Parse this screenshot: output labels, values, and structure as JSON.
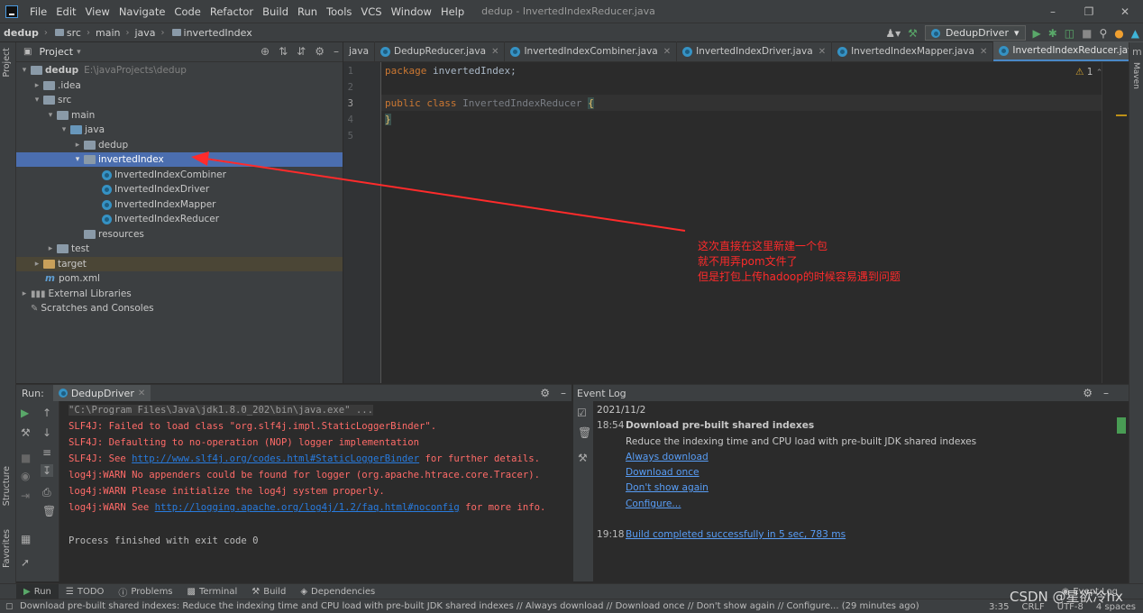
{
  "menubar": {
    "items": [
      "File",
      "Edit",
      "View",
      "Navigate",
      "Code",
      "Refactor",
      "Build",
      "Run",
      "Tools",
      "VCS",
      "Window",
      "Help"
    ],
    "window_title": "dedup - InvertedIndexReducer.java"
  },
  "navbar": {
    "crumbs": [
      "dedup",
      "src",
      "main",
      "java",
      "invertedIndex"
    ],
    "run_config": "DedupDriver"
  },
  "left_strip": {
    "tabs": [
      "Project",
      "Structure",
      "Favorites"
    ]
  },
  "right_strip": {
    "tabs": [
      "Maven"
    ]
  },
  "project": {
    "title": "Project",
    "tree": [
      {
        "label": "dedup",
        "extra": "E:\\javaProjects\\dedup"
      },
      {
        "label": ".idea"
      },
      {
        "label": "src"
      },
      {
        "label": "main"
      },
      {
        "label": "java"
      },
      {
        "label": "dedup"
      },
      {
        "label": "invertedIndex"
      },
      {
        "label": "InvertedIndexCombiner"
      },
      {
        "label": "InvertedIndexDriver"
      },
      {
        "label": "InvertedIndexMapper"
      },
      {
        "label": "InvertedIndexReducer"
      },
      {
        "label": "resources"
      },
      {
        "label": "test"
      },
      {
        "label": "target"
      },
      {
        "label": "pom.xml"
      },
      {
        "label": "External Libraries"
      },
      {
        "label": "Scratches and Consoles"
      }
    ]
  },
  "editor": {
    "tabs": [
      "java",
      "DedupReducer.java",
      "InvertedIndexCombiner.java",
      "InvertedIndexDriver.java",
      "InvertedIndexMapper.java",
      "InvertedIndexReducer.java"
    ],
    "active_tab": "InvertedIndexReducer.java",
    "line_numbers": [
      "1",
      "2",
      "3",
      "4",
      "5"
    ],
    "code": {
      "line1_kw": "package",
      "line1_rest": " invertedIndex;",
      "line3_kw": "public class",
      "line3_name": " InvertedIndexReducer ",
      "line3_brace": "{",
      "line4": "}"
    },
    "warning_count": "1"
  },
  "annotation": {
    "lines": [
      "这次直接在这里新建一个包",
      "就不用弄pom文件了",
      "但是打包上传hadoop的时候容易遇到问题"
    ],
    "color": "#ff2b2b"
  },
  "run": {
    "label": "Run:",
    "tab": "DedupDriver",
    "console": {
      "cmd": "\"C:\\Program Files\\Java\\jdk1.8.0_202\\bin\\java.exe\" ...",
      "l1": "SLF4J: Failed to load class \"org.slf4j.impl.StaticLoggerBinder\".",
      "l2": "SLF4J: Defaulting to no-operation (NOP) logger implementation",
      "l3_pre": "SLF4J: See ",
      "l3_link": "http://www.slf4j.org/codes.html#StaticLoggerBinder",
      "l3_post": " for further details.",
      "l4": "log4j:WARN No appenders could be found for logger (org.apache.htrace.core.Tracer).",
      "l5": "log4j:WARN Please initialize the log4j system properly.",
      "l6_pre": "log4j:WARN See ",
      "l6_link": "http://logging.apache.org/log4j/1.2/faq.html#noconfig",
      "l6_post": " for more info.",
      "exit": "Process finished with exit code 0"
    }
  },
  "event_log": {
    "title": "Event Log",
    "date": "2021/11/2",
    "e1_time": "18:54",
    "e1_title": "Download pre-built shared indexes",
    "e1_desc": "Reduce the indexing time and CPU load with pre-built JDK shared indexes",
    "e1_links": [
      "Always download",
      "Download once",
      "Don't show again",
      "Configure..."
    ],
    "e2_time": "19:18",
    "e2_text": "Build completed successfully in 5 sec, 783 ms"
  },
  "toolwindows": [
    "Run",
    "TODO",
    "Problems",
    "Terminal",
    "Build",
    "Dependencies"
  ],
  "event_log_button": "Event Log",
  "status": {
    "message": "Download pre-built shared indexes: Reduce the indexing time and CPU load with pre-built JDK shared indexes // Always download // Download once // Don't show again // Configure... (29 minutes ago)",
    "position": "3:35",
    "line_sep": "CRLF",
    "encoding": "UTF-8",
    "indent": "4 spaces"
  },
  "watermark": "CSDN @星欲冷hx"
}
